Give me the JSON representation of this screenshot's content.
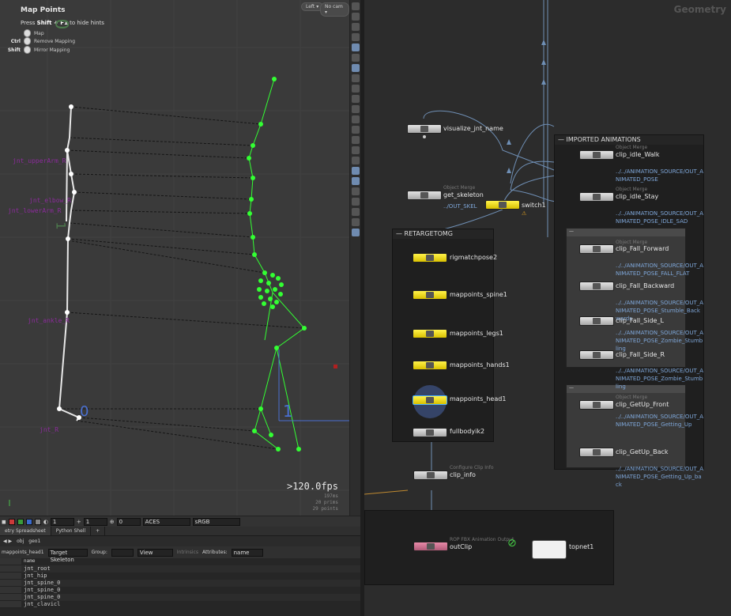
{
  "viewport": {
    "title": "Map Points",
    "hint_prefix": "Press ",
    "hint_keys": "Shift + F1",
    "hint_suffix": " to hide hints",
    "hints": [
      {
        "key": "",
        "label": "Map"
      },
      {
        "key": "Ctrl",
        "label": "Remove Mapping"
      },
      {
        "key": "Shift",
        "label": "Mirror Mapping"
      }
    ],
    "camera_view": "Left",
    "camera": "No cam",
    "fps": ">120.0fps",
    "stats": [
      "197ms",
      "20  prims",
      "29 points"
    ],
    "joint_labels": [
      "jnt_upperArm_R",
      "jnt_elbow_R",
      "jnt_lowerArm_R",
      "jnt_ankle_R",
      "jnt_R"
    ],
    "axis_labels": [
      "0",
      "1",
      "0",
      "1",
      "2"
    ]
  },
  "viewport_bar": {
    "field1": "1",
    "field2": "1",
    "field3": "0",
    "colorspace": "ACES",
    "display": "sRGB",
    "swatches": [
      "#cc3a3a",
      "#3a9c3a",
      "#3a6acc",
      "#888888"
    ]
  },
  "spreadsheet": {
    "tabs": [
      "etry Spreadsheet",
      "Python Shell"
    ],
    "path": [
      "obj",
      "geo1"
    ],
    "node": "mappoints_head1",
    "target": "Target Skeleton",
    "group_label": "Group:",
    "view_label": "View",
    "intrinsics_label": "Intrinsics",
    "attributes_label": "Attributes:",
    "attributes_value": "name",
    "column": "name",
    "rows": [
      "jnt_root",
      "jnt_hip",
      "jnt_spine_0",
      "jnt_spine_0",
      "jnt_spine_0",
      "jnt_clavicl"
    ]
  },
  "network": {
    "title": "Geometry",
    "nodes": {
      "visualize": "visualize_jnt_name",
      "get_skeleton_type": "Object Merge",
      "get_skeleton": "get_skeleton",
      "get_skeleton_path": "../OUT_SKEL",
      "switch": "switch1",
      "retarget_box": "RETARGETOMG",
      "rigmatch": "rigmatchpose2",
      "spine": "mappoints_spine1",
      "legs": "mappoints_legs1",
      "hands": "mappoints_hands1",
      "head": "mappoints_head1",
      "fullbody": "fullbodyik2",
      "clipinfo_type": "Configure Clip Info",
      "clipinfo": "clip_info",
      "rop_type": "ROP FBX Animation Output",
      "outclip": "outClip",
      "topnet": "topnet1"
    },
    "imported_box": "IMPORTED ANIMATIONS",
    "clips": [
      {
        "type": "Object Merge",
        "name": "clip_idle_Walk",
        "path": "../../ANIMATION_SOURCE/OUT_ANIMATED_POSE"
      },
      {
        "type": "Object Merge",
        "name": "clip_idle_Stay",
        "path": "../../ANIMATION_SOURCE/OUT_ANIMATED_POSE_IDLE_SAD"
      },
      {
        "type": "Object Merge",
        "name": "clip_Fall_Forward",
        "path": "../../ANIMATION_SOURCE/OUT_ANIMATED_POSE_FALL_FLAT"
      },
      {
        "type": "",
        "name": "clip_Fall_Backward",
        "path": "../../ANIMATION_SOURCE/OUT_ANIMATED_POSE_Stumble_Backwards"
      },
      {
        "type": "",
        "name": "clip_Fall_Side_L",
        "path": "../../ANIMATION_SOURCE/OUT_ANIMATED_POSE_Zombie_Stumbling"
      },
      {
        "type": "",
        "name": "clip_Fall_Side_R",
        "path": "../../ANIMATION_SOURCE/OUT_ANIMATED_POSE_Zombie_Stumbling"
      },
      {
        "type": "Object Merge",
        "name": "clip_GetUp_Front",
        "path": "../../ANIMATION_SOURCE/OUT_ANIMATED_POSE_Getting_Up"
      },
      {
        "type": "",
        "name": "clip_GetUp_Back",
        "path": "../../ANIMATION_SOURCE/OUT_ANIMATED_POSE_Getting_Up_back"
      }
    ]
  },
  "colors": {
    "skeleton_target": "#33ff33",
    "skeleton_source": "#e8e8e8",
    "joint_label": "#8b2b9b",
    "wire": "#6f8fb5",
    "path_text": "#7ea6d8"
  }
}
